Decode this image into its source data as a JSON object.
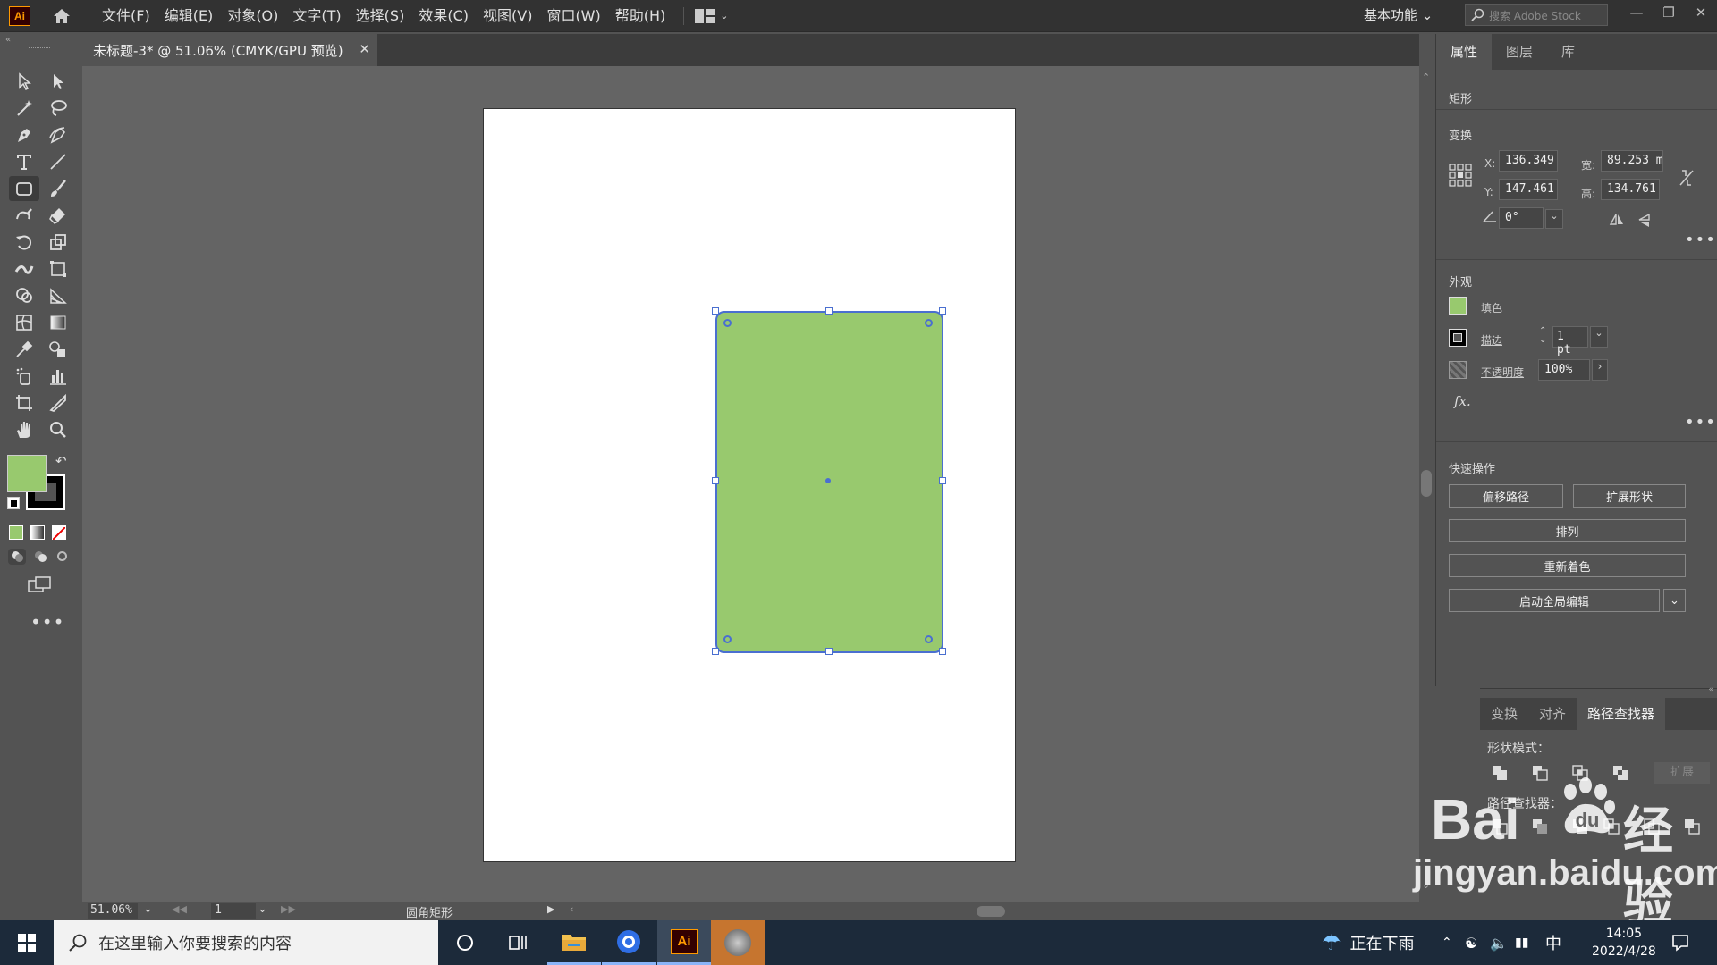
{
  "app": {
    "logo": "Ai"
  },
  "menu": [
    "文件(F)",
    "编辑(E)",
    "对象(O)",
    "文字(T)",
    "选择(S)",
    "效果(C)",
    "视图(V)",
    "窗口(W)",
    "帮助(H)"
  ],
  "workspace": "基本功能",
  "stock_search_placeholder": "搜索 Adobe Stock",
  "document_tab": "未标题-3* @ 51.06% (CMYK/GPU 预览)",
  "status": {
    "zoom": "51.06%",
    "page": "1",
    "tool": "圆角矩形"
  },
  "properties": {
    "tabs": [
      "属性",
      "图层",
      "库"
    ],
    "object_type": "矩形",
    "transform_title": "变换",
    "x_label": "X:",
    "x": "136.349",
    "y_label": "Y:",
    "y": "147.461",
    "w_label": "宽:",
    "w": "89.253 m",
    "h_label": "高:",
    "h": "134.761",
    "angle": "0°",
    "appearance_title": "外观",
    "fill_label": "填色",
    "stroke_label": "描边",
    "stroke_value": "1 pt",
    "opacity_label": "不透明度",
    "opacity_value": "100%",
    "fx": "fx.",
    "quick_actions_title": "快速操作",
    "btn_offset": "偏移路径",
    "btn_expand": "扩展形状",
    "btn_arrange": "排列",
    "btn_recolor": "重新着色",
    "btn_global_edit": "启动全局编辑"
  },
  "pathfinder": {
    "tabs": [
      "变换",
      "对齐",
      "路径查找器"
    ],
    "shape_modes": "形状模式：",
    "expand": "扩展",
    "pathfinders": "路径查找器："
  },
  "taskbar": {
    "search_placeholder": "在这里输入你要搜索的内容",
    "weather": "正在下雨",
    "ime": "中",
    "time": "14:05",
    "date": "2022/4/28"
  },
  "watermark": {
    "brand": "Bai",
    "brand2": "经验",
    "url": "jingyan.baidu.com"
  },
  "colors": {
    "fill": "#98c96e",
    "selection": "#4a6fd0"
  }
}
